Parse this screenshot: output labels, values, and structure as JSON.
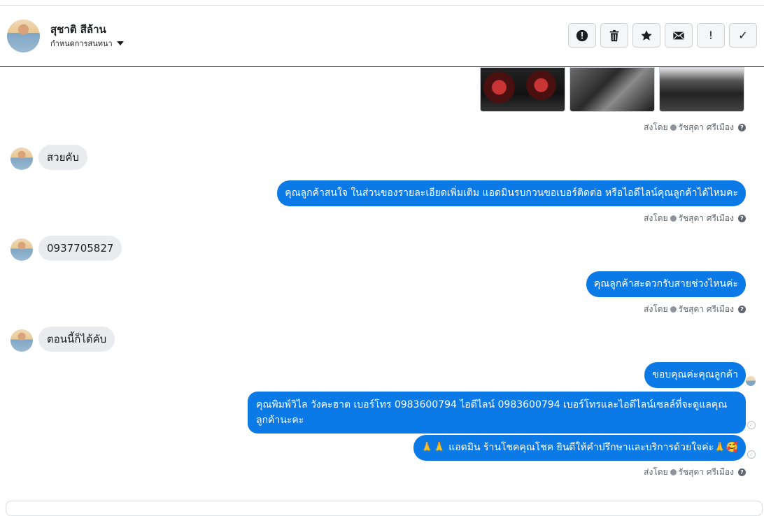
{
  "header": {
    "name": "สุชาติ สีล้าน",
    "assign_label": "กำหนดการสนทนา"
  },
  "toolbar": [
    {
      "icon": "alert-circle-icon"
    },
    {
      "icon": "trash-icon"
    },
    {
      "icon": "star-icon"
    },
    {
      "icon": "envelope-icon"
    },
    {
      "icon": "exclamation-icon",
      "glyph": "!"
    },
    {
      "icon": "checkmark-icon",
      "glyph": "✓"
    }
  ],
  "sent_by": {
    "prefix": "ส่งโดย",
    "agent": "รัชสุดา ศรีเมือง",
    "help": "?"
  },
  "messages": [
    {
      "type": "images",
      "count": 3
    },
    {
      "type": "incoming",
      "text": "สวยคับ"
    },
    {
      "type": "outgoing",
      "text": "คุณลูกค้าสนใจ ในส่วนของรายละเอียดเพิ่มเติม แอดมินรบกวนขอเบอร์ติดต่อ หรือไอดีไลน์คุณลูกค้าได้ไหมคะ"
    },
    {
      "type": "incoming",
      "text": "0937705827"
    },
    {
      "type": "outgoing",
      "text": "คุณลูกค้าสะดวกรับสายช่วงไหนค่ะ"
    },
    {
      "type": "incoming",
      "text": "ตอนนี้ก็ได้คับ"
    },
    {
      "type": "outgoing",
      "text": "ขอบคุณค่ะคุณลูกค้า"
    },
    {
      "type": "outgoing",
      "text": "คุณพิมพ์วิไล วังคะฮาต   เบอร์โทร 0983600794  ไอดีไลน์ 0983600794   เบอร์โทรและไอดีไลน์เซลล์ที่จะดูแลคุณลูกค้านะคะ"
    },
    {
      "type": "outgoing",
      "prefix_emoji": "🙏🙏",
      "text": "แอดมิน ร้านโชคคุณโชค ยินดีให้คำปรึกษาและบริการด้วยใจค่ะ",
      "suffix_emoji": "🙏🥰"
    }
  ],
  "colors": {
    "outgoing_bubble": "#0b79e6",
    "incoming_bubble": "#e9ebee"
  }
}
